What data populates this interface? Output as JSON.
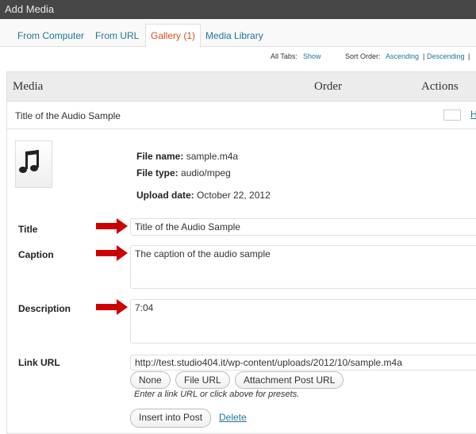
{
  "window": {
    "title": "Add Media"
  },
  "tabs": [
    {
      "label": "From Computer"
    },
    {
      "label": "From URL"
    },
    {
      "label": "Gallery (1)",
      "active": true
    },
    {
      "label": "Media Library"
    }
  ],
  "sortbar": {
    "all_tabs_label": "All Tabs:",
    "show_link": "Show",
    "sort_order_label": "Sort Order:",
    "ascending_link": "Ascending",
    "separator": "|",
    "descending_link": "Descending",
    "separator2": "|"
  },
  "table": {
    "headers": {
      "media": "Media",
      "order": "Order",
      "actions": "Actions"
    },
    "item_title": "Title of the Audio Sample",
    "hide_link": "H"
  },
  "details": {
    "file_name_label": "File name:",
    "file_name": "sample.m4a",
    "file_type_label": "File type:",
    "file_type": "audio/mpeg",
    "upload_date_label": "Upload date:",
    "upload_date": "October 22, 2012"
  },
  "form": {
    "title_label": "Title",
    "title_value": "Title of the Audio Sample",
    "caption_label": "Caption",
    "caption_value": "The caption of the audio sample",
    "description_label": "Description",
    "description_value": "7:04",
    "link_url_label": "Link URL",
    "link_url_value": "http://test.studio404.it/wp-content/uploads/2012/10/sample.m4a",
    "none_button": "None",
    "file_url_button": "File URL",
    "attachment_post_url_button": "Attachment Post URL",
    "link_hint": "Enter a link URL or click above for presets.",
    "insert_button": "Insert into Post",
    "delete_link": "Delete"
  },
  "colors": {
    "accent_link": "#21759b",
    "active_tab": "#d54e21",
    "arrow": "#cc0000",
    "titlebar": "#464646"
  }
}
